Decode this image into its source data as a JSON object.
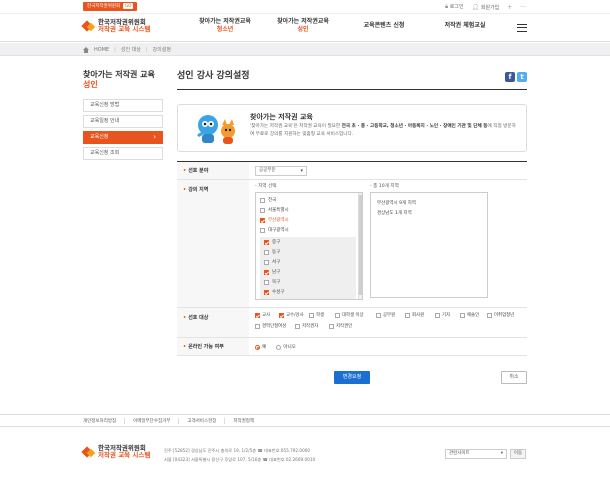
{
  "top_util": {
    "site_label": "한국저작권위원회",
    "site_go": "GO",
    "login": "로그인",
    "join": "회원가입",
    "plus": "+",
    "more": "···"
  },
  "header": {
    "logo_line1": "한국저작권위원회",
    "logo_line2": "저작권 교육 시스템",
    "menu": [
      {
        "label": "찾아가는 저작권교육",
        "sub": "청소년"
      },
      {
        "label": "찾아가는 저작권교육",
        "sub": "성인"
      },
      {
        "label": "교육콘텐츠 신청",
        "sub": ""
      },
      {
        "label": "저작권 체험교실",
        "sub": ""
      }
    ]
  },
  "breadcrumb": {
    "home": "HOME",
    "level1": "성인 대상",
    "level2": "강의설정"
  },
  "lnb": {
    "title_line1": "찾아가는 저작권 교육",
    "title_line2": "성인",
    "items": [
      {
        "label": "교육신청 방법"
      },
      {
        "label": "교육일정 안내"
      },
      {
        "label": "교육신청"
      },
      {
        "label": "교육신청 조회"
      }
    ]
  },
  "page": {
    "title": "성인 강사 강의설정",
    "sns_facebook": "f",
    "sns_twitter": "t"
  },
  "intro": {
    "title": "찾아가는 저작권 교육",
    "desc_pre": "'찾아가는 저작권 교육'은 저작권 교육이 필요한 ",
    "desc_bold1": "전국 초 · 중 · 고등학교, 청소년 · 아동복지 · 노인 · 장애인 기관 및 단체 등",
    "desc_post": "에 직접 방문하여 무료로 강의를 지원하는 맞춤형 교육 서비스입니다."
  },
  "form": {
    "field_label": "선호 분야",
    "field_value": "공공부문",
    "region_label": "강의 지역",
    "region_left_title": "- 지역 선택",
    "region_right_title": "- 총 10개 지역",
    "regions": [
      {
        "label": "전국",
        "checked": false
      },
      {
        "label": "서울특별시",
        "checked": false
      },
      {
        "label": "부산광역시",
        "checked": true
      },
      {
        "label": "대구광역시",
        "checked": false
      }
    ],
    "subregions": [
      {
        "label": "중구",
        "checked": true
      },
      {
        "label": "동구",
        "checked": false
      },
      {
        "label": "서구",
        "checked": false
      },
      {
        "label": "남구",
        "checked": true
      },
      {
        "label": "북구",
        "checked": false
      },
      {
        "label": "수성구",
        "checked": true
      }
    ],
    "selected_regions": [
      "부산광역시 9개 지역",
      "경상남도 1개 지역"
    ],
    "target_label": "선호 대상",
    "targets": [
      {
        "label": "교사",
        "checked": true
      },
      {
        "label": "교수/강사",
        "checked": true
      },
      {
        "label": "학생",
        "checked": false
      },
      {
        "label": "대학생 이상",
        "checked": false
      },
      {
        "label": "공무원",
        "checked": false
      },
      {
        "label": "회사원",
        "checked": false
      },
      {
        "label": "기자",
        "checked": false
      },
      {
        "label": "예술인",
        "checked": false
      },
      {
        "label": "미취업청년",
        "checked": false
      },
      {
        "label": "경력단절여성",
        "checked": false
      },
      {
        "label": "저작권자",
        "checked": false
      },
      {
        "label": "저작권인",
        "checked": false
      }
    ],
    "online_label": "온라인 가능 여부",
    "online_yes": "예",
    "online_no": "아니오"
  },
  "buttons": {
    "submit": "변경요청",
    "cancel": "취소"
  },
  "footer": {
    "links": [
      "개인정보처리방침",
      "이메일무단수집거부",
      "고객서비스헌장",
      "저작권정책"
    ],
    "logo_line1": "한국저작권위원회",
    "logo_line2": "저작권 교육 시스템",
    "addr1": "진주 [52852] 경상남도 진주시 충의로 19, 1/2/5층 ☎ 대표번호 055.792.0000",
    "addr2": "서울 [04323] 서울특별시 용산구 후암로 107, 5/16층 ☎ 대표번호 02.2669.0010",
    "family_site": "관련사이트",
    "go": "이동"
  },
  "colors": {
    "accent": "#e8541e",
    "primary_button": "#1a6fd0"
  }
}
